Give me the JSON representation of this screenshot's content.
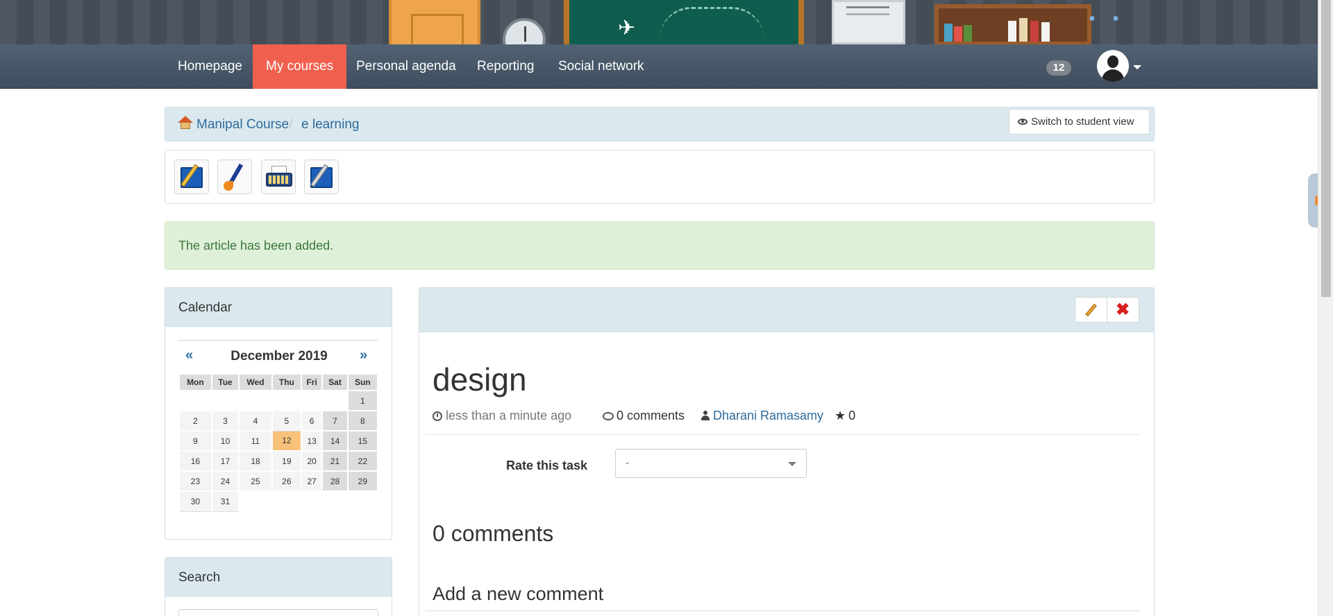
{
  "navbar": {
    "items": [
      {
        "label": "Homepage"
      },
      {
        "label": "My courses"
      },
      {
        "label": "Personal agenda"
      },
      {
        "label": "Reporting"
      },
      {
        "label": "Social network"
      }
    ],
    "active_item": "My courses",
    "notifications_count": "12"
  },
  "breadcrumb": {
    "items": [
      {
        "label": "Manipal Course"
      },
      {
        "label": "e learning"
      }
    ],
    "separator": "/"
  },
  "student_view_button": "Switch to student view",
  "toolbar_icons": [
    "new-article-icon",
    "paint-brush-icon",
    "typewriter-icon",
    "edit-page-icon"
  ],
  "alert": {
    "message": "The article has been added."
  },
  "calendar": {
    "title": "Calendar",
    "prev": "«",
    "next": "»",
    "month_label": "December 2019",
    "weekdays": [
      "Mon",
      "Tue",
      "Wed",
      "Thu",
      "Fri",
      "Sat",
      "Sun"
    ],
    "weeks": [
      [
        "",
        "",
        "",
        "",
        "",
        "",
        "1"
      ],
      [
        "2",
        "3",
        "4",
        "5",
        "6",
        "7",
        "8"
      ],
      [
        "9",
        "10",
        "11",
        "12",
        "13",
        "14",
        "15"
      ],
      [
        "16",
        "17",
        "18",
        "19",
        "20",
        "21",
        "22"
      ],
      [
        "23",
        "24",
        "25",
        "26",
        "27",
        "28",
        "29"
      ],
      [
        "30",
        "31",
        "",
        "",
        "",
        "",
        ""
      ]
    ],
    "today": "12"
  },
  "search": {
    "title": "Search"
  },
  "article": {
    "title": "design",
    "posted": "less than a minute ago",
    "comments_count": "0 comments",
    "author": "Dharani Ramasamy",
    "rating": "0",
    "rate_label": "Rate this task",
    "rate_value": "-",
    "comments_heading": "0 comments",
    "add_comment_heading": "Add a new comment"
  },
  "colors": {
    "nav_active": "#f1604f",
    "panel_header": "#dbe9ef",
    "alert_bg": "#dff0d8",
    "link": "#2c6b9c",
    "today_cell": "#f8c27a"
  }
}
